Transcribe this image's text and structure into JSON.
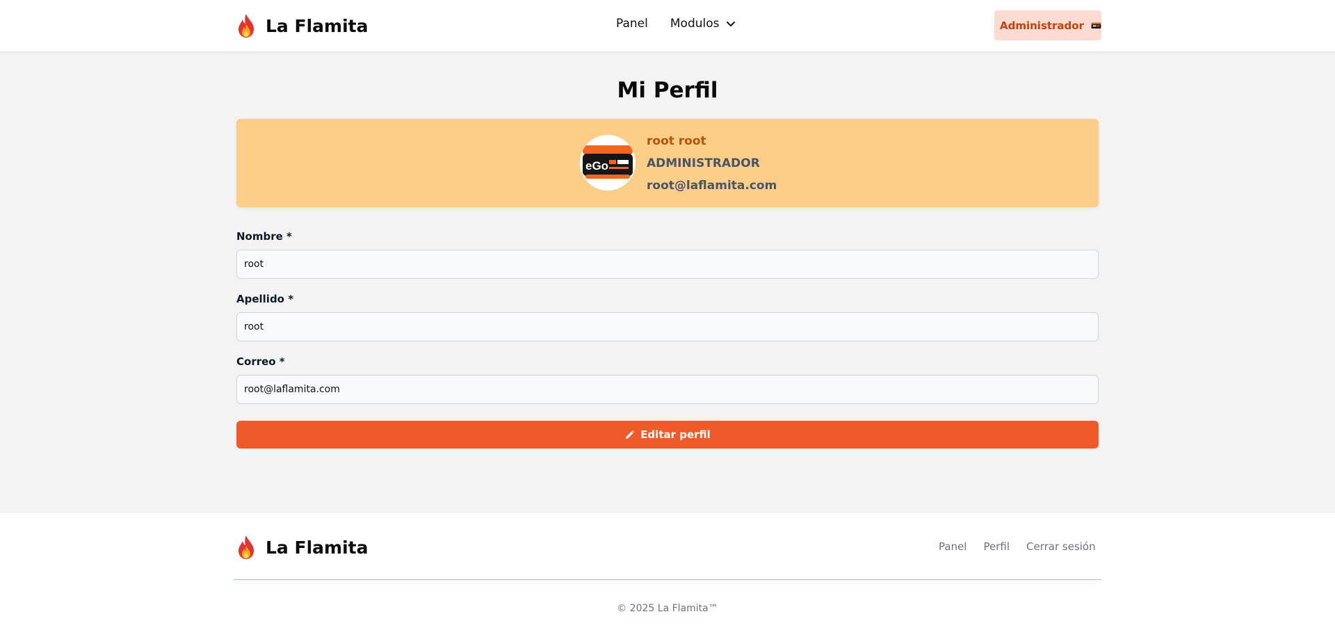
{
  "header": {
    "brand": "La Flamita",
    "nav": {
      "panel": "Panel",
      "modules": "Modulos"
    },
    "user_button": "Administrador"
  },
  "page": {
    "title": "Mi Perfil"
  },
  "profile": {
    "name": "root root",
    "role": "ADMINISTRADOR",
    "email": "root@laflamita.com",
    "avatar_text": "eGo"
  },
  "form": {
    "first_name": {
      "label": "Nombre *",
      "value": "root"
    },
    "last_name": {
      "label": "Apellido *",
      "value": "root"
    },
    "email": {
      "label": "Correo *",
      "value": "root@laflamita.com"
    },
    "submit": "Editar perfil"
  },
  "footer": {
    "brand": "La Flamita",
    "links": {
      "panel": "Panel",
      "profile": "Perfil",
      "logout": "Cerrar sesión"
    },
    "copyright": "© 2025 La Flamita™"
  },
  "colors": {
    "accent": "#f05a28",
    "card": "#fdce87",
    "admin_bg": "#fcdcd2",
    "admin_text": "#c2410c"
  }
}
